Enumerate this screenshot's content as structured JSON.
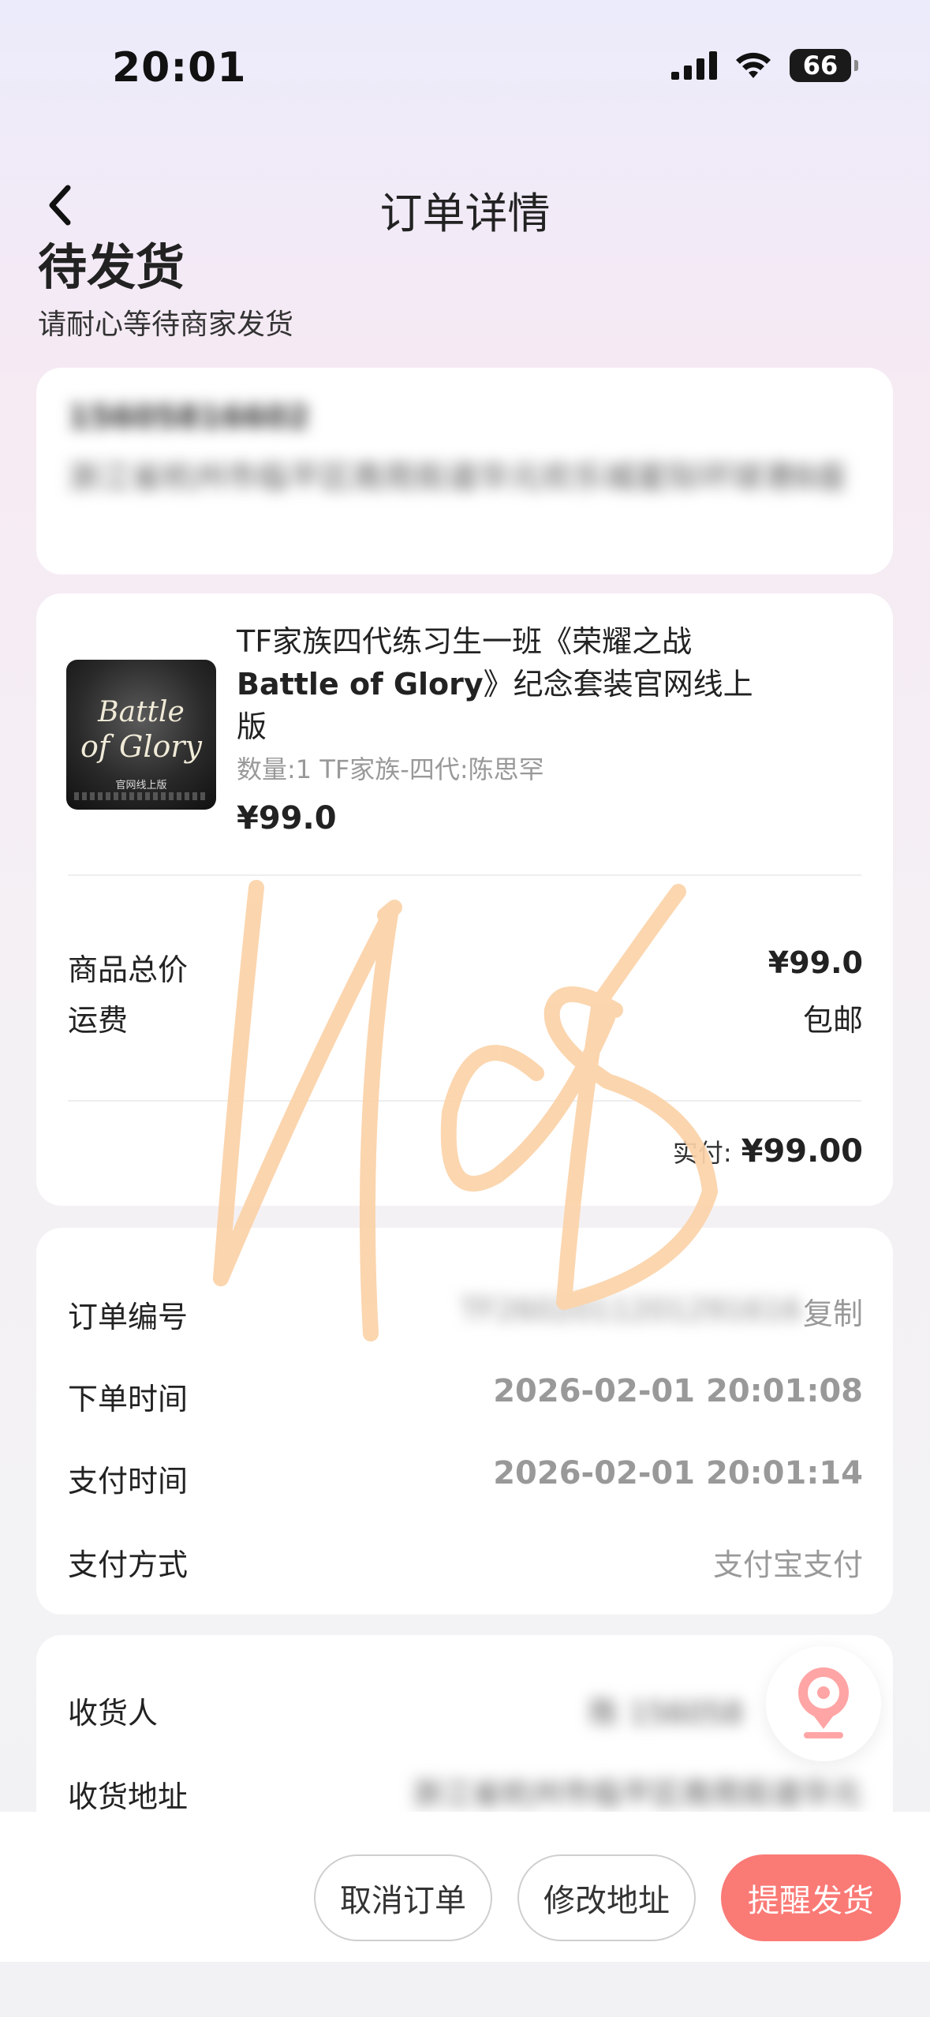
{
  "status_bar": {
    "time": "20:01",
    "battery": "66"
  },
  "header": {
    "title": "订单详情"
  },
  "order_status": {
    "heading": "待发货",
    "subtitle": "请耐心等待商家发货"
  },
  "address_card": {
    "phone": "15605816602",
    "address": "浙江省杭州市临平区南苑街道华元欢乐城星际环球港B座"
  },
  "product": {
    "image_title_1": "Battle",
    "image_title_2": "of Glory",
    "image_caption": "官网线上版",
    "title_line1": "TF家族四代练习生一班《荣耀之战",
    "title_line2_bold": "Battle of Glory",
    "title_line2_rest": "》纪念套装官网线上",
    "title_line3": "版",
    "spec": "数量:1 TF家族-四代:陈思罕",
    "price": "¥99.0"
  },
  "price_summary": {
    "subtotal_label": "商品总价",
    "subtotal_value": "¥99.0",
    "shipping_label": "运费",
    "shipping_value": "包邮",
    "paid_label": "实付:",
    "paid_value": "¥99.00"
  },
  "order_info": {
    "order_no_label": "订单编号",
    "order_no_value": "TF2602011201291616",
    "copy_label": "复制",
    "order_time_label": "下单时间",
    "order_time_value": "2026-02-01 20:01:08",
    "pay_time_label": "支付时间",
    "pay_time_value": "2026-02-01 20:01:14",
    "pay_method_label": "支付方式",
    "pay_method_value": "支付宝支付"
  },
  "receiver": {
    "name_label": "收货人",
    "name_value": "陈 156058",
    "address_label": "收货地址",
    "address_value": "浙江省杭州市临平区南苑街道华元"
  },
  "actions": {
    "cancel": "取消订单",
    "modify": "修改地址",
    "remind": "提醒发货"
  },
  "colors": {
    "accent": "#fa7a76",
    "signature": "#fbd2a8"
  }
}
